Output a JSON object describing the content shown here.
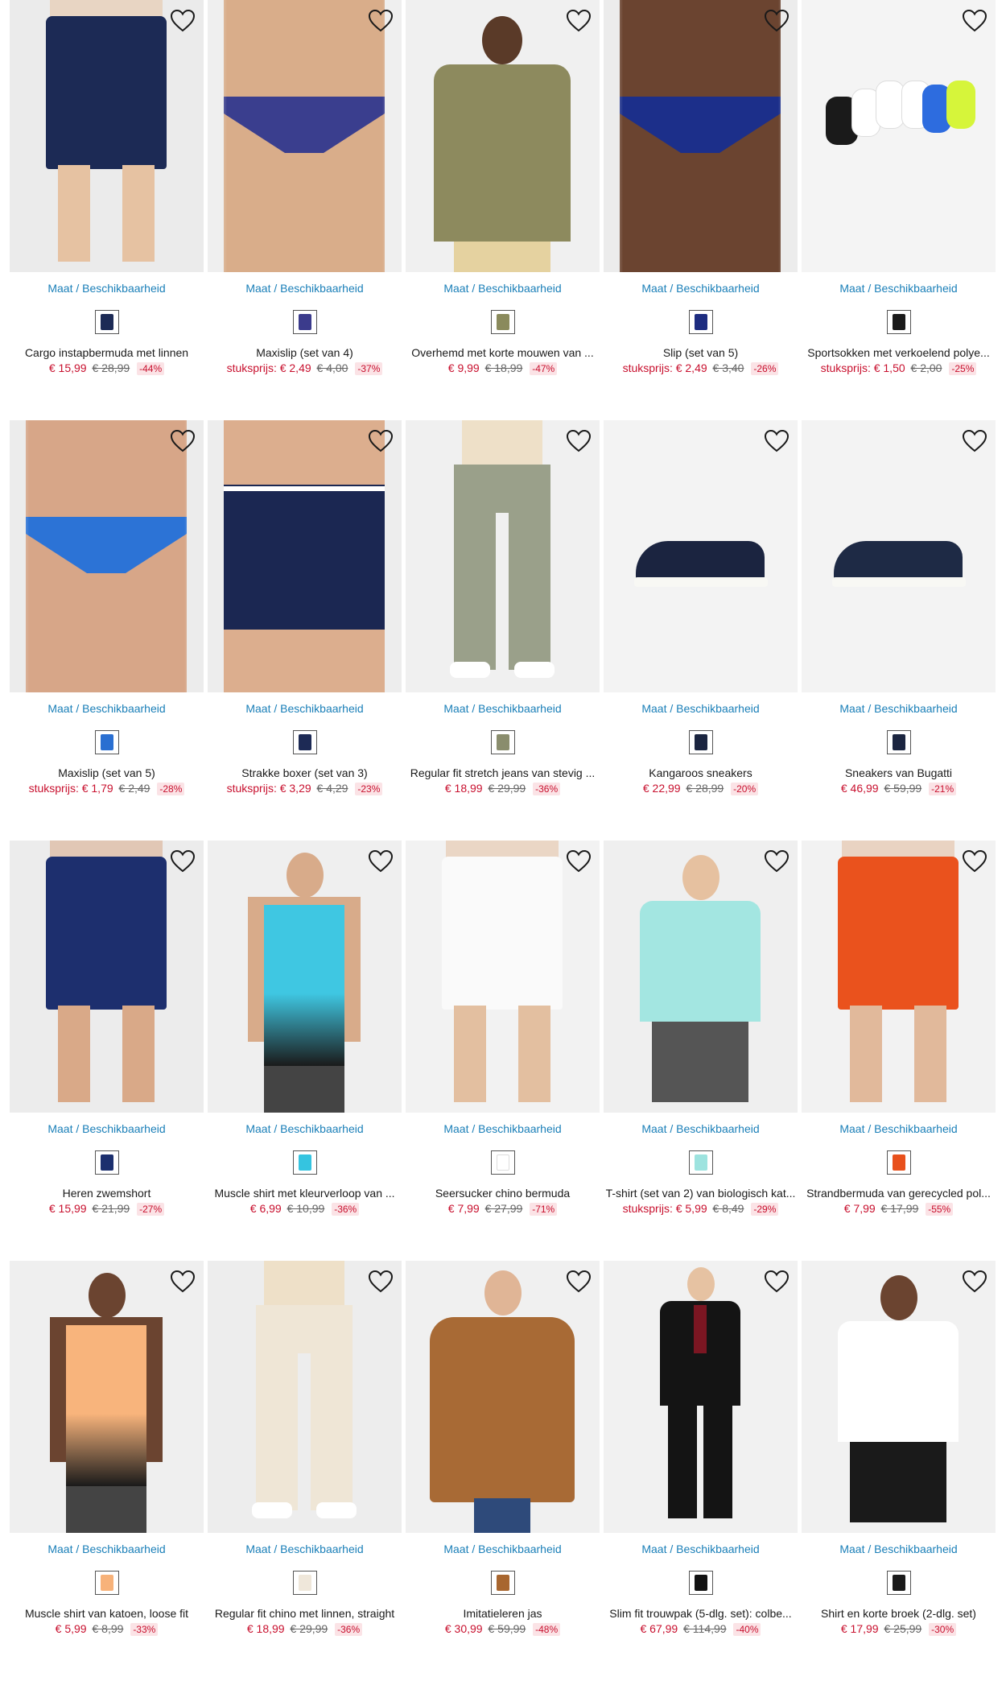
{
  "common": {
    "size_link": "Maat / Beschikbaarheid"
  },
  "products": [
    {
      "title": "Cargo instapbermuda met linnen",
      "price_label": "",
      "price": "€ 15,99",
      "old_price": "€ 28,99",
      "discount": "-44%",
      "swatch": "#1c2a55",
      "bg": "#ebebeb",
      "garment": "#1c2a55",
      "skin": "#e6c2a2",
      "type": "shorts"
    },
    {
      "title": "Maxislip (set van 4)",
      "price_label": "stuksprijs:",
      "price": "€ 2,49",
      "old_price": "€ 4,00",
      "discount": "-37%",
      "swatch": "#3b3b8c",
      "bg": "#efefef",
      "garment": "#3a3e8e",
      "skin": "#d9ad8a",
      "type": "brief"
    },
    {
      "title": "Overhemd met korte mouwen van ...",
      "price_label": "",
      "price": "€ 9,99",
      "old_price": "€ 18,99",
      "discount": "-47%",
      "swatch": "#8a8a5c",
      "bg": "#f0f0f0",
      "garment": "#8d8a5e",
      "skin": "#5a3a28",
      "type": "shirt"
    },
    {
      "title": "Slip (set van 5)",
      "price_label": "stuksprijs:",
      "price": "€ 2,49",
      "old_price": "€ 3,40",
      "discount": "-26%",
      "swatch": "#1d2c80",
      "bg": "#ececec",
      "garment": "#1c2f8a",
      "skin": "#6b4430",
      "type": "brief"
    },
    {
      "title": "Sportsokken met verkoelend polye...",
      "price_label": "stuksprijs:",
      "price": "€ 1,50",
      "old_price": "€ 2,00",
      "discount": "-25%",
      "swatch": "#1a1a1a",
      "bg": "#f4f4f4",
      "garment": "#2d6cdf",
      "skin": "#f4f4f4",
      "type": "socks"
    },
    {
      "title": "Maxislip (set van 5)",
      "price_label": "stuksprijs:",
      "price": "€ 1,79",
      "old_price": "€ 2,49",
      "discount": "-28%",
      "swatch": "#2a6fd1",
      "bg": "#ececec",
      "garment": "#2c73d6",
      "skin": "#d7a688",
      "type": "brief"
    },
    {
      "title": "Strakke boxer (set van 3)",
      "price_label": "stuksprijs:",
      "price": "€ 3,29",
      "old_price": "€ 4,29",
      "discount": "-23%",
      "swatch": "#1d2a55",
      "bg": "#ededed",
      "garment": "#1b2752",
      "skin": "#dcae8e",
      "type": "boxer"
    },
    {
      "title": "Regular fit stretch jeans van stevig ...",
      "price_label": "",
      "price": "€ 18,99",
      "old_price": "€ 29,99",
      "discount": "-36%",
      "swatch": "#8a8d6d",
      "bg": "#f0f0f0",
      "garment": "#9aa08a",
      "skin": "#e7c3a6",
      "type": "jeans"
    },
    {
      "title": "Kangaroos sneakers",
      "price_label": "",
      "price": "€ 22,99",
      "old_price": "€ 28,99",
      "discount": "-20%",
      "swatch": "#1b2540",
      "bg": "#f3f3f3",
      "garment": "#1b2440",
      "skin": "#f3f3f3",
      "type": "shoe"
    },
    {
      "title": "Sneakers van Bugatti",
      "price_label": "",
      "price": "€ 46,99",
      "old_price": "€ 59,99",
      "discount": "-21%",
      "swatch": "#1b2540",
      "bg": "#f3f3f3",
      "garment": "#1e2a45",
      "skin": "#f3f3f3",
      "type": "shoe"
    },
    {
      "title": "Heren zwemshort",
      "price_label": "",
      "price": "€ 15,99",
      "old_price": "€ 21,99",
      "discount": "-27%",
      "swatch": "#1c2f6e",
      "bg": "#ececec",
      "garment": "#1d2f6e",
      "skin": "#d9a988",
      "type": "shorts"
    },
    {
      "title": "Muscle shirt met kleurverloop van ...",
      "price_label": "",
      "price": "€ 6,99",
      "old_price": "€ 10,99",
      "discount": "-36%",
      "swatch": "#35c4e0",
      "bg": "#efefef",
      "garment": "#3fc7e2",
      "skin": "#d8ab8a",
      "type": "tank"
    },
    {
      "title": "Seersucker chino bermuda",
      "price_label": "",
      "price": "€ 7,99",
      "old_price": "€ 27,99",
      "discount": "-71%",
      "swatch": "#ffffff",
      "bg": "#f2f2f2",
      "garment": "#fafafa",
      "skin": "#e3bfa0",
      "type": "shorts"
    },
    {
      "title": "T-shirt (set van 2) van biologisch kat...",
      "price_label": "stuksprijs:",
      "price": "€ 5,99",
      "old_price": "€ 8,49",
      "discount": "-29%",
      "swatch": "#9de3df",
      "bg": "#efefef",
      "garment": "#a3e6e1",
      "skin": "#e6c1a0",
      "type": "tshirt"
    },
    {
      "title": "Strandbermuda van gerecycled pol...",
      "price_label": "",
      "price": "€ 7,99",
      "old_price": "€ 17,99",
      "discount": "-55%",
      "swatch": "#e8501c",
      "bg": "#f2f2f2",
      "garment": "#ea521d",
      "skin": "#e1b99b",
      "type": "shorts"
    },
    {
      "title": "Muscle shirt van katoen, loose fit",
      "price_label": "",
      "price": "€ 5,99",
      "old_price": "€ 8,99",
      "discount": "-33%",
      "swatch": "#f7b27a",
      "bg": "#efefef",
      "garment": "#f8b47c",
      "skin": "#6b4430",
      "type": "tank"
    },
    {
      "title": "Regular fit chino met linnen, straight",
      "price_label": "",
      "price": "€ 18,99",
      "old_price": "€ 29,99",
      "discount": "-36%",
      "swatch": "#efe7da",
      "bg": "#ededed",
      "garment": "#efe6d6",
      "skin": "#e0b798",
      "type": "jeans"
    },
    {
      "title": "Imitatieleren jas",
      "price_label": "",
      "price": "€ 30,99",
      "old_price": "€ 59,99",
      "discount": "-48%",
      "swatch": "#a8662f",
      "bg": "#f0f0f0",
      "garment": "#a86a35",
      "skin": "#e0b596",
      "type": "jacket"
    },
    {
      "title": "Slim fit trouwpak (5-dlg. set): colbe...",
      "price_label": "",
      "price": "€ 67,99",
      "old_price": "€ 114,99",
      "discount": "-40%",
      "swatch": "#111111",
      "bg": "#f1f1f1",
      "garment": "#141414",
      "skin": "#e6c2a2",
      "type": "suit"
    },
    {
      "title": "Shirt en korte broek (2-dlg. set)",
      "price_label": "",
      "price": "€ 17,99",
      "old_price": "€ 25,99",
      "discount": "-30%",
      "swatch": "#1a1a1a",
      "bg": "#f1f1f1",
      "garment": "#1a1a1a",
      "skin": "#6b4430",
      "type": "tshirt"
    }
  ]
}
